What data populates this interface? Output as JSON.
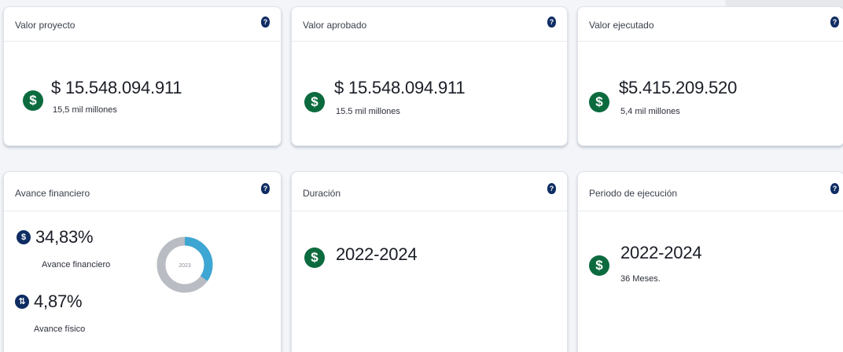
{
  "info_glyph": "?",
  "currency_glyph": "$",
  "physical_glyph": "⇅",
  "cards": {
    "valor_proyecto": {
      "title": "Valor proyecto",
      "value": "$ 15.548.094.911",
      "subtitle": "15,5 mil millones"
    },
    "valor_aprobado": {
      "title": "Valor aprobado",
      "value": "$ 15.548.094.911",
      "subtitle": "15.5 mil millones"
    },
    "valor_ejecutado": {
      "title": "Valor ejecutado",
      "value": "$5.415.209.520",
      "subtitle": "5,4 mil millones"
    },
    "avance_financiero": {
      "title": "Avance financiero",
      "financiero_value": "34,83%",
      "financiero_label": "Avance financiero",
      "fisico_value": "4,87%",
      "fisico_label": "Avance físico",
      "donut_label": "2023",
      "donut_progress_fraction": 0.3483
    },
    "duracion": {
      "title": "Duración",
      "value": "2022-2024"
    },
    "periodo_ejecucion": {
      "title": "Periodo de ejecución",
      "value": "2022-2024",
      "subtitle": "36 Meses."
    }
  },
  "colors": {
    "currency_icon": "#0c6b3e",
    "info_icon": "#0f2c63",
    "donut_progress": "#3ea6d3",
    "donut_track": "#b9bcc2"
  }
}
